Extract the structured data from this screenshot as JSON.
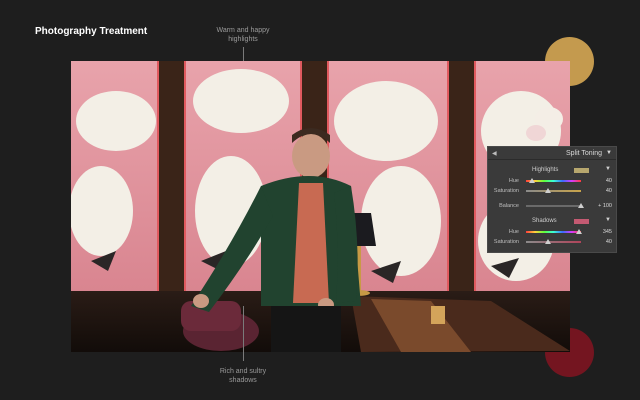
{
  "title": "Photography Treatment",
  "annotations": {
    "top": [
      "Warm and happy",
      "highlights"
    ],
    "bottom": [
      "Rich and sultry",
      "shadows"
    ]
  },
  "colors": {
    "background": "#1e1e1e",
    "warm_swatch": "#c49a4e",
    "rich_swatch": "#741520",
    "highlight_tint": "#b7a76e",
    "shadow_tint": "#c45a72"
  },
  "panel": {
    "title": "Split Toning",
    "collapse_icon": "triangle-collapse-icon",
    "menu_icon": "dropdown-triangle-icon",
    "highlights": {
      "label": "Highlights",
      "hue_label": "Hue",
      "hue_value": "40",
      "hue_fraction": 0.11,
      "saturation_label": "Saturation",
      "saturation_value": "40",
      "saturation_fraction": 0.4
    },
    "balance": {
      "label": "Balance",
      "value": "+ 100",
      "fraction": 1.0
    },
    "shadows": {
      "label": "Shadows",
      "hue_label": "Hue",
      "hue_value": "345",
      "hue_fraction": 0.96,
      "saturation_label": "Saturation",
      "saturation_value": "40",
      "saturation_fraction": 0.4
    }
  }
}
